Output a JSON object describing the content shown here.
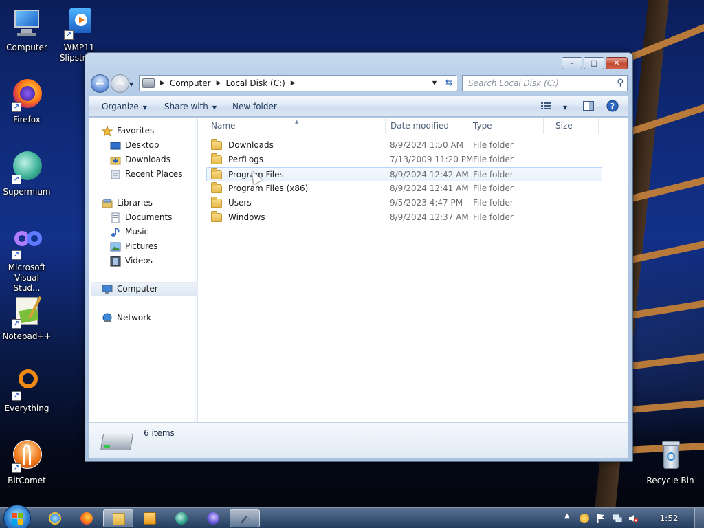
{
  "desktop": {
    "icons": [
      {
        "label": "Computer",
        "icon": "computer-icon"
      },
      {
        "label": "WMP11 Slipstre...",
        "icon": "wmp-installer-icon"
      },
      {
        "label": "Firefox",
        "icon": "firefox-icon"
      },
      {
        "label": "Supermium",
        "icon": "supermium-icon"
      },
      {
        "label": "Microsoft Visual Stud...",
        "icon": "visual-studio-icon"
      },
      {
        "label": "Notepad++",
        "icon": "notepadpp-icon"
      },
      {
        "label": "Everything",
        "icon": "everything-icon"
      },
      {
        "label": "BitComet",
        "icon": "bitcomet-icon"
      },
      {
        "label": "Recycle Bin",
        "icon": "recycle-bin-icon"
      }
    ]
  },
  "window": {
    "caption_buttons": {
      "minimize": "–",
      "maximize": "□",
      "close": "✕"
    },
    "address": {
      "crumbs": [
        "Computer",
        "Local Disk (C:)"
      ]
    },
    "search_placeholder": "Search Local Disk (C:)",
    "toolbar": {
      "organize": "Organize",
      "share_with": "Share with",
      "new_folder": "New folder"
    },
    "sidebar": {
      "favorites_header": "Favorites",
      "favorites": [
        "Desktop",
        "Downloads",
        "Recent Places"
      ],
      "libraries_header": "Libraries",
      "libraries": [
        "Documents",
        "Music",
        "Pictures",
        "Videos"
      ],
      "computer": "Computer",
      "network": "Network"
    },
    "columns": {
      "name": "Name",
      "date": "Date modified",
      "type": "Type",
      "size": "Size"
    },
    "rows": [
      {
        "name": "Downloads",
        "date": "8/9/2024 1:50 AM",
        "type": "File folder"
      },
      {
        "name": "PerfLogs",
        "date": "7/13/2009 11:20 PM",
        "type": "File folder"
      },
      {
        "name": "Program Files",
        "date": "8/9/2024 12:42 AM",
        "type": "File folder"
      },
      {
        "name": "Program Files (x86)",
        "date": "8/9/2024 12:41 AM",
        "type": "File folder"
      },
      {
        "name": "Users",
        "date": "9/5/2023 4:47 PM",
        "type": "File folder"
      },
      {
        "name": "Windows",
        "date": "8/9/2024 12:37 AM",
        "type": "File folder"
      }
    ],
    "hovered_row": "Program Files",
    "status": {
      "item_count": "6 items"
    }
  },
  "taskbar": {
    "pinned": [
      "start-orb",
      "internet-explorer-icon",
      "firefox-icon",
      "explorer-icon",
      "media-player-icon",
      "supermium-icon",
      "firefox-nightly-icon",
      "tool-icon"
    ],
    "active": "explorer-icon",
    "clock": "1:52 AM"
  },
  "colors": {
    "accent": "#2a5cb4",
    "selection_border": "#b8d6fb",
    "close_red": "#c24a32"
  }
}
